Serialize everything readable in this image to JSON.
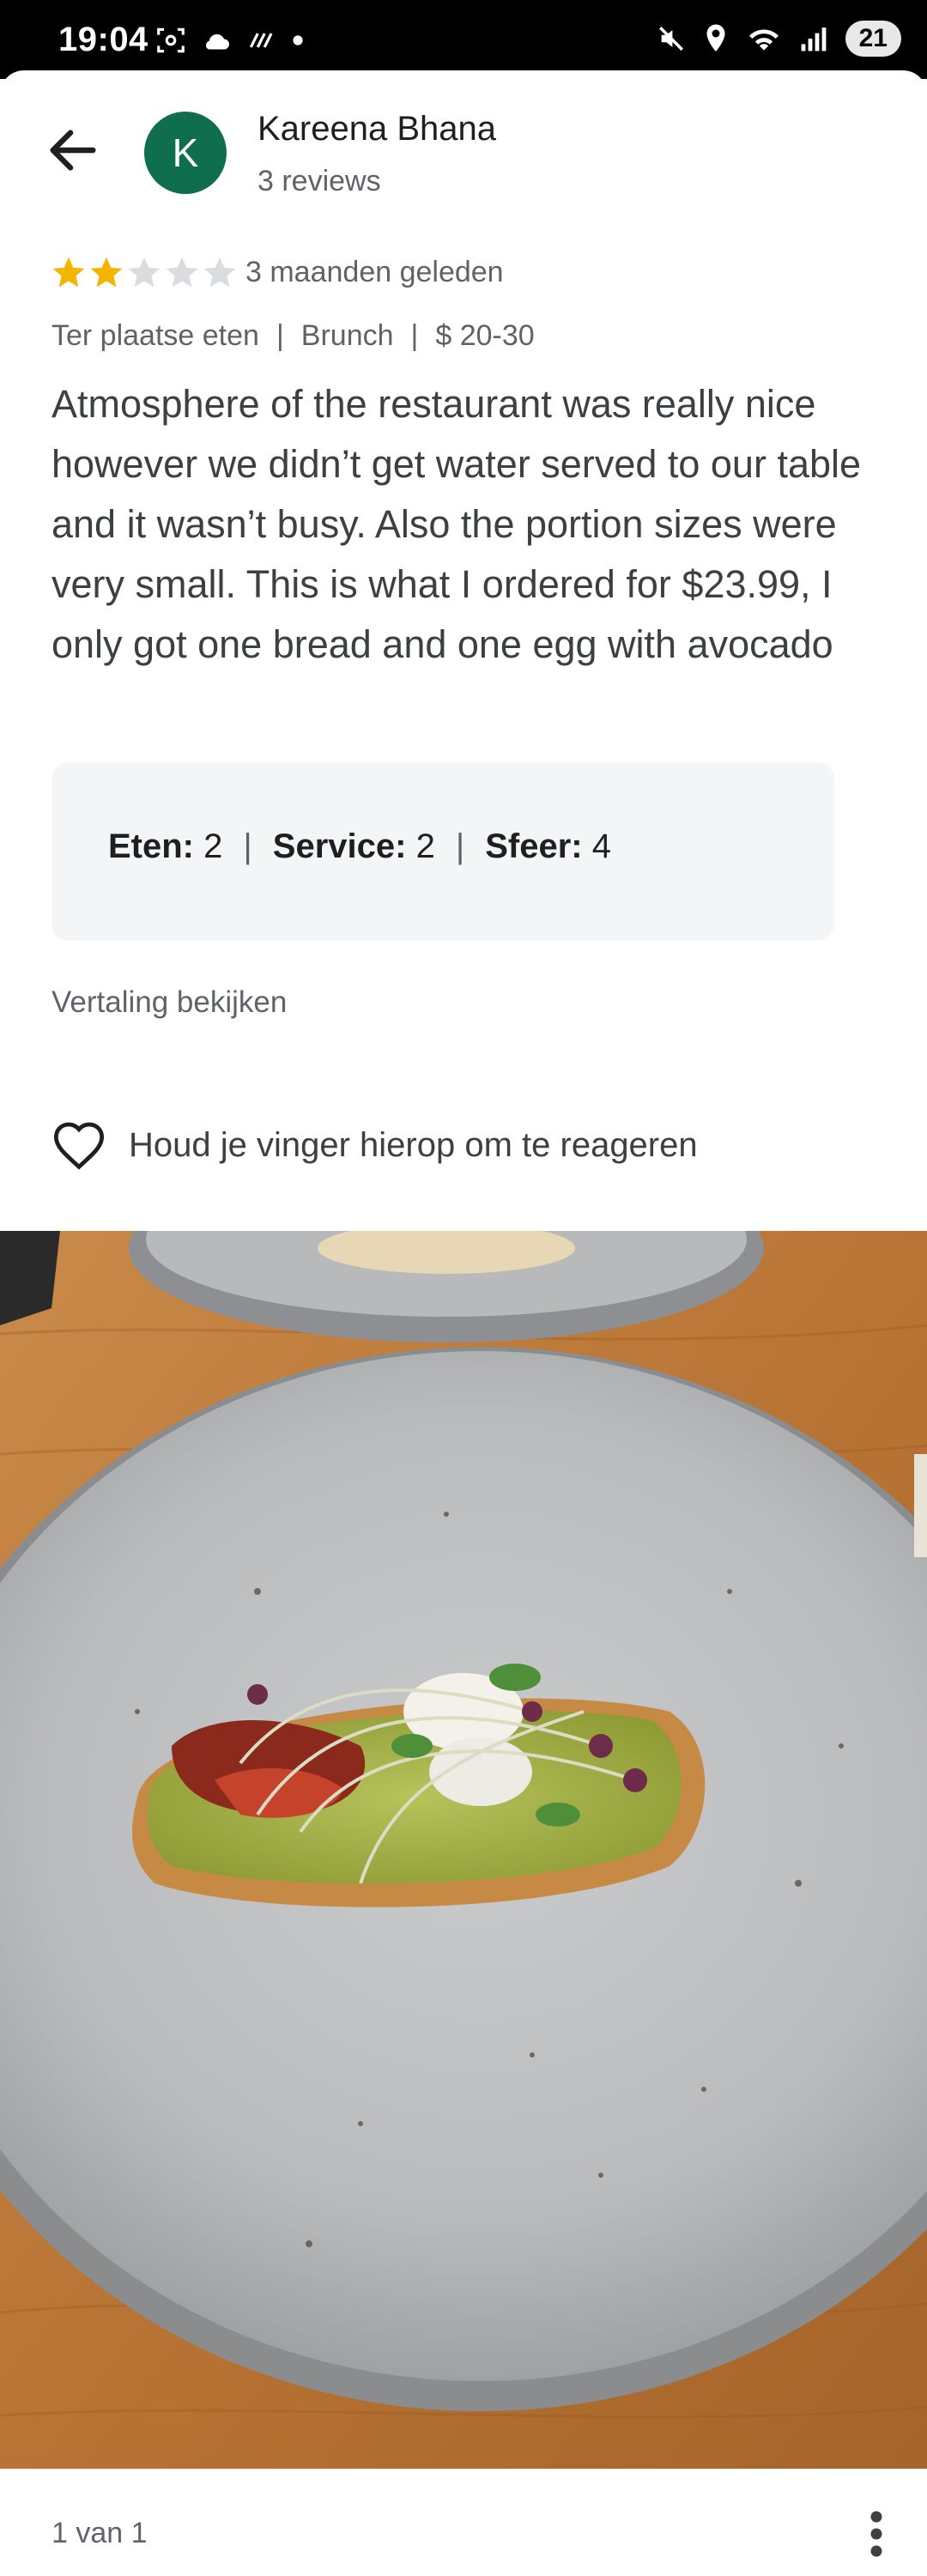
{
  "status_bar": {
    "time": "19:04",
    "battery": "21",
    "icons": [
      "screenshot-icon",
      "cloud-icon",
      "data-saver-icon",
      "dot-icon",
      "mute-icon",
      "location-icon",
      "wifi-icon",
      "signal-icon"
    ]
  },
  "header": {
    "back_icon": "arrow-left-icon",
    "avatar_letter": "K",
    "avatar_color": "#0f6e4e",
    "author_name": "Kareena Bhana",
    "author_reviews": "3 reviews"
  },
  "review": {
    "rating": 2,
    "max_rating": 5,
    "date": "3 maanden geleden",
    "meta": [
      "Ter plaatse eten",
      "Brunch",
      "$ 20-30"
    ],
    "meta_separator": "|",
    "text": "Atmosphere of the restaurant was really nice however we didn’t get water served to our table and it wasn’t busy. Also the portion sizes were very small. This is what I ordered for $23.99, I only got one bread and one egg with avocado",
    "sub_ratings": [
      {
        "label": "Eten:",
        "value": "2"
      },
      {
        "label": "Service:",
        "value": "2"
      },
      {
        "label": "Sfeer:",
        "value": "4"
      }
    ],
    "translate_label": "Vertaling bekijken",
    "react_label": "Houd je vinger hierop om te reageren"
  },
  "photo": {
    "description_icon": "photo"
  },
  "footer": {
    "page_indicator": "1 van 1",
    "more_icon": "more-vertical-icon"
  },
  "colors": {
    "star_filled": "#f4b400",
    "star_empty": "#dadce0",
    "muted_text": "#5f6368"
  }
}
